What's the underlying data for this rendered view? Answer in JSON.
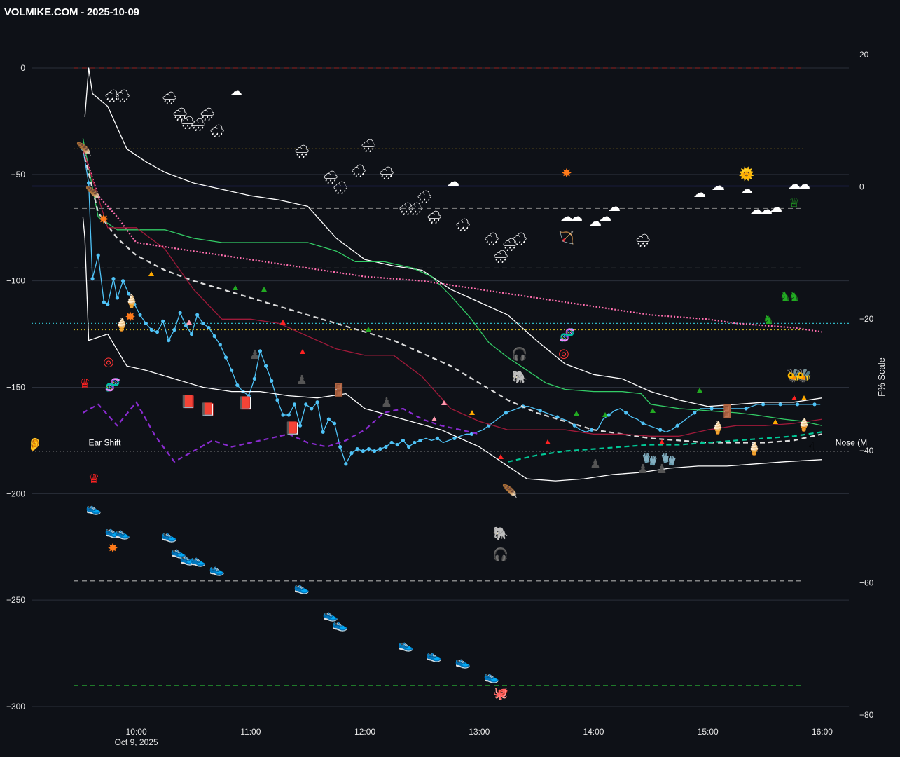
{
  "title": "VOLMIKE.COM  - 2025-10-09",
  "chart_data": {
    "type": "line",
    "title": "VOLMIKE.COM  - 2025-10-09",
    "xlabel": "",
    "ylabel": "",
    "y2label": "F% Scale",
    "x_ticks": [
      "10:00",
      "11:00",
      "12:00",
      "13:00",
      "14:00",
      "15:00",
      "16:00"
    ],
    "x_date_label": "Oct 9, 2025",
    "ylim": [
      -300,
      0
    ],
    "y_ticks": [
      0,
      -50,
      -100,
      -150,
      -200,
      -250,
      -300
    ],
    "y2lim": [
      -80,
      20
    ],
    "y2_ticks": [
      20,
      0,
      -20,
      -40,
      -60,
      -80
    ],
    "grid": true,
    "reference_lines": [
      {
        "y": 0,
        "color": "#7a2020",
        "style": "dashed"
      },
      {
        "y": -38,
        "color": "#9a7d1a",
        "style": "dotted"
      },
      {
        "y": -55.5,
        "color": "#3a3aa8",
        "style": "solid"
      },
      {
        "y": -66,
        "color": "#777777",
        "style": "dashed"
      },
      {
        "y": -94,
        "color": "#777777",
        "style": "dashed"
      },
      {
        "y": -120,
        "color": "#2fb6c4",
        "style": "dotted"
      },
      {
        "y": -123,
        "color": "#c8b020",
        "style": "dotted"
      },
      {
        "y": -180,
        "color": "#dddddd",
        "style": "dotted"
      },
      {
        "y": -241,
        "color": "#aaaaaa",
        "style": "dashed"
      },
      {
        "y": -290,
        "color": "#1f7a2a",
        "style": "dashed"
      }
    ],
    "annotations": [
      {
        "text": "Ear Shift",
        "time": "09:32",
        "y": -176
      },
      {
        "text": "Nose (M",
        "time": "16:04",
        "y": -176
      }
    ],
    "series": [
      {
        "color": "#4fc3f7",
        "x": [
          "09:32",
          "09:35",
          "09:37",
          "09:40",
          "09:43",
          "09:45",
          "09:48",
          "09:50",
          "09:53",
          "09:56",
          "09:59",
          "10:02",
          "10:05",
          "10:08",
          "10:11",
          "10:14",
          "10:17",
          "10:20",
          "10:23",
          "10:26",
          "10:29",
          "10:32",
          "10:35",
          "10:38",
          "10:41",
          "10:44",
          "10:47",
          "10:50",
          "10:53",
          "10:56",
          "10:59",
          "11:02",
          "11:05",
          "11:08",
          "11:11",
          "11:14",
          "11:17",
          "11:20",
          "11:23",
          "11:26",
          "11:29",
          "11:32",
          "11:35",
          "11:38",
          "11:41",
          "11:44",
          "11:47",
          "11:50",
          "11:53",
          "11:56",
          "11:59",
          "12:02",
          "12:05",
          "12:08",
          "12:11",
          "12:14",
          "12:17",
          "12:20",
          "12:23",
          "12:26",
          "12:29",
          "12:32",
          "12:35",
          "12:38",
          "12:41",
          "12:44",
          "12:47",
          "12:50",
          "12:53",
          "12:56",
          "12:59",
          "13:02",
          "13:05",
          "13:08",
          "13:11",
          "13:14",
          "13:17",
          "13:20",
          "13:23",
          "13:26",
          "13:29",
          "13:32",
          "13:35",
          "13:38",
          "13:41",
          "13:44",
          "13:47",
          "13:50",
          "13:53",
          "13:56",
          "13:59",
          "14:02",
          "14:05",
          "14:08",
          "14:11",
          "14:14",
          "14:17",
          "14:20",
          "14:23",
          "14:26",
          "14:29",
          "14:32",
          "14:35",
          "14:38",
          "14:41",
          "14:44",
          "14:47",
          "14:50",
          "14:53",
          "14:56",
          "14:59",
          "15:02",
          "15:05",
          "15:08",
          "15:11",
          "15:14",
          "15:17",
          "15:20",
          "15:23",
          "15:26",
          "15:29",
          "15:32",
          "15:35",
          "15:38",
          "15:41",
          "15:44",
          "15:47",
          "15:50",
          "15:53",
          "15:56",
          "15:59"
        ],
        "values": [
          -38,
          -54,
          -99,
          -88,
          -110,
          -111,
          -99,
          -108,
          -100,
          -106,
          -111,
          -116,
          -120,
          -123,
          -124,
          -119,
          -128,
          -123,
          -115,
          -121,
          -125,
          -116,
          -120,
          -122,
          -126,
          -130,
          -136,
          -142,
          -149,
          -152,
          -154,
          -146,
          -133,
          -140,
          -147,
          -156,
          -163,
          -163,
          -158,
          -168,
          -158,
          -160,
          -157,
          -171,
          -165,
          -167,
          -178,
          -186,
          -181,
          -179,
          -180,
          -179,
          -180,
          -179,
          -178,
          -176,
          -177,
          -175,
          -178,
          -176,
          -175,
          -174,
          -175,
          -174,
          -176,
          -175,
          -174,
          -173,
          -172,
          -172,
          -171,
          -170,
          -168,
          -166,
          -164,
          -162,
          -161,
          -160,
          -159,
          -159,
          -160,
          -161,
          -162,
          -163,
          -164,
          -165,
          -166,
          -168,
          -170,
          -171,
          -170,
          -170,
          -165,
          -163,
          -161,
          -160,
          -162,
          -164,
          -165,
          -167,
          -168,
          -169,
          -170,
          -171,
          -170,
          -168,
          -166,
          -164,
          -162,
          -160,
          -160,
          -160,
          -160,
          -160,
          -160,
          -160,
          -160,
          -160,
          -159,
          -158,
          -158,
          -158,
          -158,
          -158,
          -158,
          -158,
          -158,
          -158,
          -158,
          -158,
          -158
        ]
      },
      {
        "color": "#ffffff",
        "x": [
          "09:33",
          "09:35",
          "09:37",
          "09:45",
          "09:55",
          "10:05",
          "10:15",
          "10:30",
          "10:45",
          "11:00",
          "11:15",
          "11:30",
          "11:45",
          "12:00",
          "12:15",
          "12:30",
          "12:45",
          "13:00",
          "13:15",
          "13:30",
          "13:45",
          "14:00",
          "14:15",
          "14:30",
          "14:45",
          "15:00",
          "15:15",
          "15:30",
          "15:45",
          "16:00"
        ],
        "values": [
          -23,
          0,
          -12,
          -18,
          -38,
          -44,
          -49,
          -54,
          -57,
          -60,
          -62,
          -65,
          -80,
          -90,
          -93,
          -95,
          -104,
          -110,
          -116,
          -128,
          -139,
          -144,
          -146,
          -152,
          -156,
          -159,
          -158,
          -157,
          -157,
          -155
        ]
      },
      {
        "color": "#ffffff",
        "x": [
          "09:32",
          "09:33",
          "09:35",
          "09:45",
          "09:55",
          "10:05",
          "10:20",
          "10:35",
          "10:50",
          "11:05",
          "11:20",
          "11:35",
          "11:50",
          "12:00",
          "12:20",
          "12:40",
          "13:00",
          "13:15",
          "13:25",
          "13:40",
          "13:55",
          "14:10",
          "14:25",
          "14:40",
          "14:55",
          "15:10",
          "15:25",
          "15:40",
          "16:00"
        ],
        "values": [
          -70,
          -80,
          -128,
          -125,
          -140,
          -142,
          -146,
          -150,
          -152,
          -152,
          -154,
          -155,
          -153,
          -160,
          -165,
          -170,
          -178,
          -187,
          -193,
          -194,
          -193,
          -191,
          -190,
          -188,
          -187,
          -187,
          -186,
          -185,
          -184
        ]
      },
      {
        "color": "#33cc66",
        "x": [
          "09:32",
          "09:40",
          "09:50",
          "10:00",
          "10:15",
          "10:30",
          "10:45",
          "11:00",
          "11:15",
          "11:30",
          "11:45",
          "11:55",
          "12:10",
          "12:25",
          "12:35",
          "12:45",
          "12:55",
          "13:05",
          "13:15",
          "13:25",
          "13:35",
          "13:45",
          "14:00",
          "14:15",
          "14:25",
          "14:30",
          "14:45",
          "15:00",
          "15:15",
          "15:25",
          "15:40",
          "15:50",
          "16:00"
        ],
        "values": [
          -33,
          -70,
          -76,
          -76,
          -76,
          -80,
          -82,
          -82,
          -82,
          -82,
          -86,
          -91,
          -91,
          -94,
          -98,
          -107,
          -117,
          -129,
          -136,
          -142,
          -148,
          -151,
          -152,
          -152,
          -153,
          -158,
          -160,
          -161,
          -162,
          -163,
          -165,
          -166,
          -168
        ]
      },
      {
        "color": "#ff6fae",
        "style": "dotted",
        "x": [
          "09:32",
          "09:40",
          "09:50",
          "10:00",
          "10:15",
          "10:30",
          "10:45",
          "11:00",
          "11:15",
          "11:30",
          "11:45",
          "12:00",
          "12:15",
          "12:30",
          "12:45",
          "13:00",
          "13:15",
          "13:30",
          "13:45",
          "14:00",
          "14:15",
          "14:30",
          "14:45",
          "15:00",
          "15:15",
          "15:30",
          "15:45",
          "16:00"
        ],
        "values": [
          -38,
          -60,
          -70,
          -82,
          -84,
          -86,
          -88,
          -90,
          -92,
          -94,
          -96,
          -98,
          -99,
          -100,
          -102,
          -104,
          -106,
          -108,
          -110,
          -112,
          -114,
          -116,
          -117,
          -118,
          -120,
          -121,
          -122,
          -124
        ]
      },
      {
        "color": "#dddddd",
        "style": "dashed",
        "x": [
          "09:32",
          "09:40",
          "09:50",
          "10:00",
          "10:15",
          "10:30",
          "10:45",
          "11:00",
          "11:15",
          "11:30",
          "11:45",
          "12:00",
          "12:15",
          "12:30",
          "12:45",
          "13:00",
          "13:15",
          "13:30",
          "13:45",
          "14:00",
          "14:15",
          "14:30",
          "14:45",
          "15:00",
          "15:15",
          "15:30",
          "15:45",
          "16:00"
        ],
        "values": [
          -38,
          -68,
          -80,
          -88,
          -95,
          -100,
          -104,
          -108,
          -112,
          -116,
          -120,
          -124,
          -128,
          -134,
          -140,
          -148,
          -156,
          -162,
          -166,
          -170,
          -172,
          -174,
          -175,
          -176,
          -176,
          -176,
          -175,
          -172
        ]
      },
      {
        "color": "#00c896",
        "style": "dashed",
        "x": [
          "13:15",
          "13:30",
          "13:45",
          "14:00",
          "14:15",
          "14:30",
          "14:45",
          "15:00",
          "15:15",
          "15:30",
          "15:45",
          "16:00"
        ],
        "values": [
          -185,
          -182,
          -180,
          -179,
          -178,
          -177,
          -177,
          -176,
          -175,
          -174,
          -173,
          -171
        ]
      },
      {
        "color": "#a01a3a",
        "x": [
          "09:32",
          "09:45",
          "10:00",
          "10:15",
          "10:30",
          "10:45",
          "11:00",
          "11:15",
          "11:30",
          "11:45",
          "12:00",
          "12:15",
          "12:30",
          "12:45",
          "13:00",
          "13:15",
          "13:30",
          "13:45",
          "14:00",
          "14:15",
          "14:30",
          "14:45",
          "15:00",
          "15:15",
          "15:30",
          "15:45",
          "16:00"
        ],
        "values": [
          -38,
          -75,
          -75,
          -85,
          -104,
          -118,
          -118,
          -120,
          -126,
          -132,
          -135,
          -135,
          -145,
          -160,
          -166,
          -170,
          -170,
          -170,
          -172,
          -172,
          -173,
          -173,
          -170,
          -168,
          -168,
          -167,
          -165
        ]
      },
      {
        "color": "#8a2bd0",
        "style": "dashed",
        "x": [
          "09:32",
          "09:40",
          "09:50",
          "10:00",
          "10:10",
          "10:20",
          "10:30",
          "10:40",
          "10:50",
          "11:00",
          "11:10",
          "11:20",
          "11:30",
          "11:40",
          "11:50",
          "12:00",
          "12:10",
          "12:20",
          "12:30",
          "12:40",
          "12:50",
          "13:00"
        ],
        "values": [
          -162,
          -158,
          -168,
          -157,
          -173,
          -185,
          -180,
          -175,
          -178,
          -176,
          -174,
          -172,
          -176,
          -178,
          -175,
          -170,
          -162,
          -160,
          -165,
          -168,
          -170,
          -172
        ]
      }
    ],
    "markers": [
      {
        "name": "rain-cloud",
        "count": 30
      },
      {
        "name": "cloud",
        "count": 14
      },
      {
        "name": "shoe",
        "count": 20
      },
      {
        "name": "sun",
        "count": 1
      }
    ]
  },
  "emoji": {
    "rain": "🌧",
    "cloud": "☁",
    "shoe": "👟",
    "sun": "🌞",
    "crown": "♛",
    "pawn": "♟",
    "knight": "♞",
    "queen": "♕",
    "ear": "👂",
    "hand": "☝",
    "bee": "🐝",
    "target": "◎",
    "dna": "🧬",
    "elephant": "🐘",
    "headphones": "🎧",
    "octopus": "🐙",
    "burst": "✸",
    "ice": "🍦",
    "book": "📕",
    "glove": "🧤",
    "door": "🚪",
    "tri_up": "▲",
    "bow": "🏹",
    "feather": "🪶"
  }
}
